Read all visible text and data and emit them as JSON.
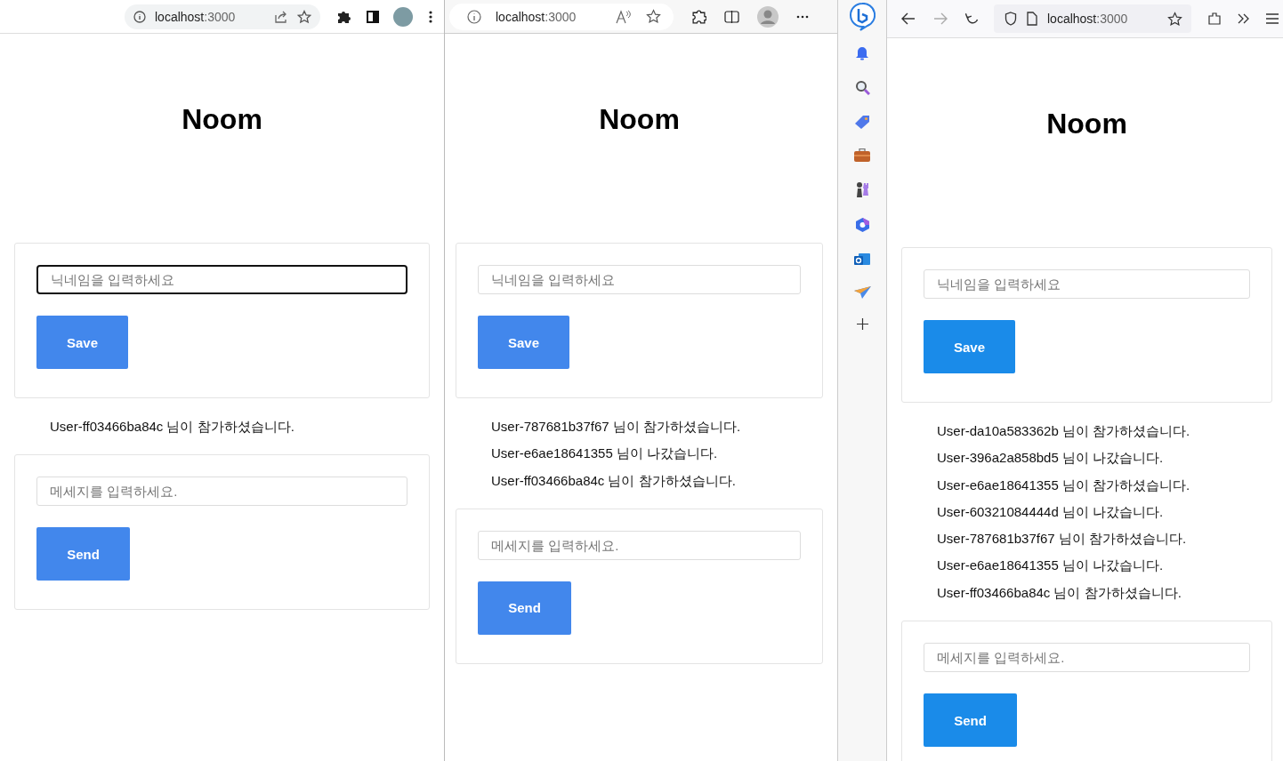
{
  "windows": [
    {
      "kind": "chrome",
      "address_host": "localhost",
      "address_port": ":3000",
      "page": {
        "title": "Noom",
        "nickname": {
          "placeholder": "닉네임을 입력하세요",
          "focused": true
        },
        "save_button": "Save",
        "messages": [
          "User-ff03466ba84c 님이 참가하셨습니다."
        ],
        "message": {
          "placeholder": "메세지를 입력하세요.",
          "focused": false
        },
        "send_button": "Send"
      }
    },
    {
      "kind": "edge",
      "address_host": "localhost",
      "address_port": ":3000",
      "page": {
        "title": "Noom",
        "nickname": {
          "placeholder": "닉네임을 입력하세요",
          "focused": false
        },
        "save_button": "Save",
        "messages": [
          "User-787681b37f67 님이 참가하셨습니다.",
          "User-e6ae18641355 님이 나갔습니다.",
          "User-ff03466ba84c 님이 참가하셨습니다."
        ],
        "message": {
          "placeholder": "메세지를 입력하세요.",
          "focused": false
        },
        "send_button": "Send"
      }
    },
    {
      "kind": "firefox",
      "address_host": "localhost",
      "address_port": ":3000",
      "page": {
        "title": "Noom",
        "nickname": {
          "placeholder": "닉네임을 입력하세요",
          "focused": false
        },
        "save_button": "Save",
        "messages": [
          "User-da10a583362b 님이 참가하셨습니다.",
          "User-396a2a858bd5 님이 나갔습니다.",
          "User-e6ae18641355 님이 참가하셨습니다.",
          "User-60321084444d 님이 나갔습니다.",
          "User-787681b37f67 님이 참가하셨습니다.",
          "User-e6ae18641355 님이 나갔습니다.",
          "User-ff03466ba84c 님이 참가하셨습니다."
        ],
        "message": {
          "placeholder": "메세지를 입력하세요.",
          "focused": false
        },
        "send_button": "Send"
      }
    }
  ]
}
